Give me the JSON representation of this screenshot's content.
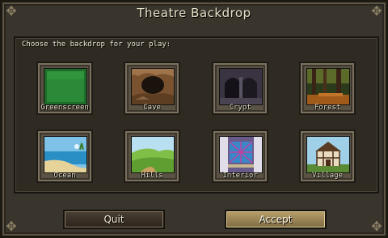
{
  "dialog": {
    "title": "Theatre Backdrop",
    "prompt": "Choose the backdrop for your play:"
  },
  "backdrops": [
    {
      "label": "Greenscreen",
      "icon": "greenscreen-image"
    },
    {
      "label": "Cave",
      "icon": "cave-image"
    },
    {
      "label": "Crypt",
      "icon": "crypt-image"
    },
    {
      "label": "Forest",
      "icon": "forest-image"
    },
    {
      "label": "Ocean",
      "icon": "ocean-image"
    },
    {
      "label": "Hills",
      "icon": "hills-image"
    },
    {
      "label": "Interior",
      "icon": "interior-image"
    },
    {
      "label": "Village",
      "icon": "village-image"
    }
  ],
  "buttons": {
    "quit": "Quit",
    "accept": "Accept"
  },
  "colors": {
    "frame": "#3a352c",
    "accept_gold": "#b8a06a",
    "text": "#e8e0c8"
  }
}
